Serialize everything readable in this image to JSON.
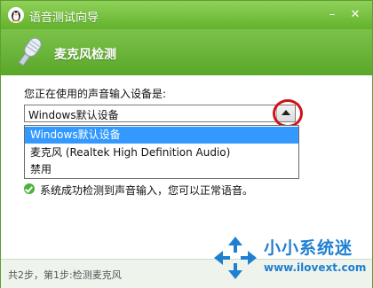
{
  "window": {
    "title": "语音测试向导",
    "minimize_glyph": "–",
    "close_glyph": "✕"
  },
  "header": {
    "section_title": "麦克风检测",
    "icon": "microphone-icon"
  },
  "device": {
    "prompt": "您正在使用的声音输入设备是:",
    "selected_value": "Windows默认设备",
    "options": [
      "Windows默认设备",
      "麦克风 (Realtek High Definition Audio)",
      "禁用"
    ],
    "highlighted_index": 0
  },
  "status": {
    "text": "系统成功检测到声音输入，您可以正常语音。",
    "icon": "check-circle-icon"
  },
  "footer": {
    "step_text": "共2步，第1步:检测麦克风"
  },
  "watermark": {
    "title": "小小系统迷",
    "url": "www.ilovext.com"
  },
  "colors": {
    "title_bar": "#63b22c",
    "header_band": "#5aa729",
    "selection": "#3399ff",
    "highlight_ring": "#d0111a",
    "watermark_blue": "#1f7fd1"
  }
}
